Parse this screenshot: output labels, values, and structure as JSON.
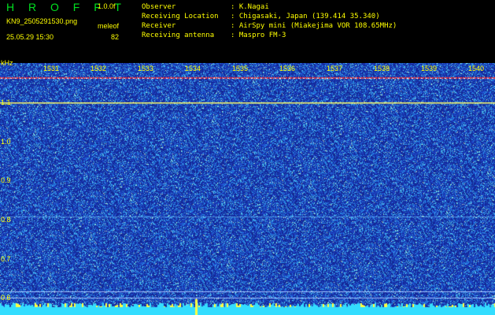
{
  "header": {
    "app_title": "H R O F F T",
    "version": "1.0.0f",
    "file_name": "KN9_2505291530.png",
    "meter_label": "meleof",
    "date_time": "25.05.29 15:30",
    "meter_value": "82"
  },
  "info": [
    {
      "key": "Observer",
      "value": ": K.Nagai"
    },
    {
      "key": "Receiving Location",
      "value": ": Chigasaki, Japan (139.414 35.340)"
    },
    {
      "key": "Receiver",
      "value": ": AirSpy mini (Miakejima VOR 108.65MHz)"
    },
    {
      "key": "Receiving antenna",
      "value": ": Maspro FM-3"
    }
  ],
  "axis": {
    "unit": "kHz",
    "y_labels": [
      "1.1",
      "1.0",
      "0.9",
      "0.8",
      "0.7",
      "0.6"
    ],
    "x_labels": [
      "1531",
      "1532",
      "1533",
      "1534",
      "1535",
      "1536",
      "1537",
      "1538",
      "1539",
      "1540"
    ]
  },
  "colors": {
    "background": "#000000",
    "spectrum_base": "#1a2fa0",
    "text": "#ffff00",
    "title": "#00e020",
    "signal_line": "#ffff66",
    "band_red": "#ff3030",
    "floor": "#33ddff"
  }
}
